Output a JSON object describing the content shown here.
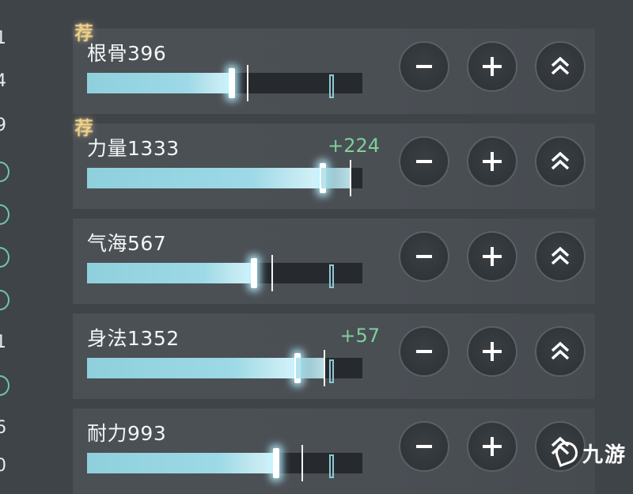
{
  "left_column": [
    "1",
    "4",
    "9",
    "",
    "",
    "",
    "",
    "1",
    "",
    "6",
    "0"
  ],
  "stats": [
    {
      "name": "根骨",
      "value": "396",
      "bonus": "",
      "recommended": true,
      "badge": "荐",
      "fill": 0.52,
      "cursor": 0.58,
      "bonus_fill": 0,
      "tick": 0.88
    },
    {
      "name": "力量",
      "value": "1333",
      "bonus": "+224",
      "recommended": true,
      "badge": "荐",
      "fill": 0.85,
      "cursor": 0.955,
      "bonus_fill": 0.1,
      "tick": null
    },
    {
      "name": "气海",
      "value": "567",
      "bonus": "",
      "recommended": false,
      "badge": "",
      "fill": 0.6,
      "cursor": 0.67,
      "bonus_fill": 0,
      "tick": 0.88
    },
    {
      "name": "身法",
      "value": "1352",
      "bonus": "+57",
      "recommended": false,
      "badge": "",
      "fill": 0.76,
      "cursor": 0.86,
      "bonus_fill": 0.09,
      "tick": 0.88
    },
    {
      "name": "耐力",
      "value": "993",
      "bonus": "",
      "recommended": false,
      "badge": "",
      "fill": 0.68,
      "cursor": 0.78,
      "bonus_fill": 0,
      "tick": 0.88
    }
  ],
  "buttons": {
    "minus_icon": "minus-icon",
    "plus_icon": "plus-icon",
    "upgrade_icon": "double-chevron-up-icon"
  },
  "colors": {
    "background": "#3f4449",
    "bar_fill": "#9dd9e6",
    "bonus_text": "#7fcf9c",
    "badge": "#f3d28a"
  },
  "watermark": {
    "text": "九游",
    "icon": "jiuyou-logo-icon"
  }
}
